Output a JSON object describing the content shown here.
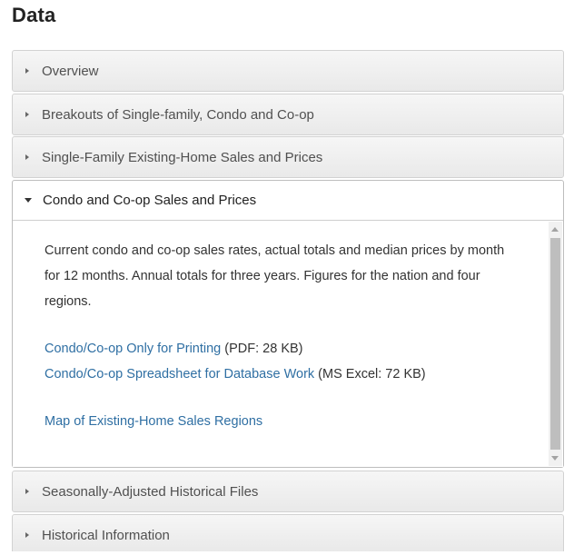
{
  "page": {
    "title": "Data"
  },
  "accordion": {
    "sections": [
      {
        "label": "Overview",
        "expanded": false
      },
      {
        "label": "Breakouts of Single-family, Condo and Co-op",
        "expanded": false
      },
      {
        "label": "Single-Family Existing-Home Sales and Prices",
        "expanded": false
      },
      {
        "label": "Condo and Co-op Sales and Prices",
        "expanded": true
      },
      {
        "label": "Seasonally-Adjusted Historical Files",
        "expanded": false
      },
      {
        "label": "Historical Information",
        "expanded": false
      }
    ],
    "open_panel": {
      "description": "Current condo and co-op sales rates, actual totals and median prices by month for 12 months. Annual totals for three years. Figures for the nation and four regions.",
      "links": [
        {
          "label": "Condo/Co-op Only for Printing",
          "suffix": " (PDF: 28 KB)"
        },
        {
          "label": "Condo/Co-op Spreadsheet for Database Work",
          "suffix": " (MS Excel: 72 KB)"
        }
      ],
      "map_link": "Map of Existing-Home Sales Regions"
    }
  },
  "icons": {
    "collapsed": "caret-right-icon",
    "expanded": "caret-down-icon"
  },
  "colors": {
    "link": "#2f6fa3",
    "header_bg": "#eeeeee"
  }
}
